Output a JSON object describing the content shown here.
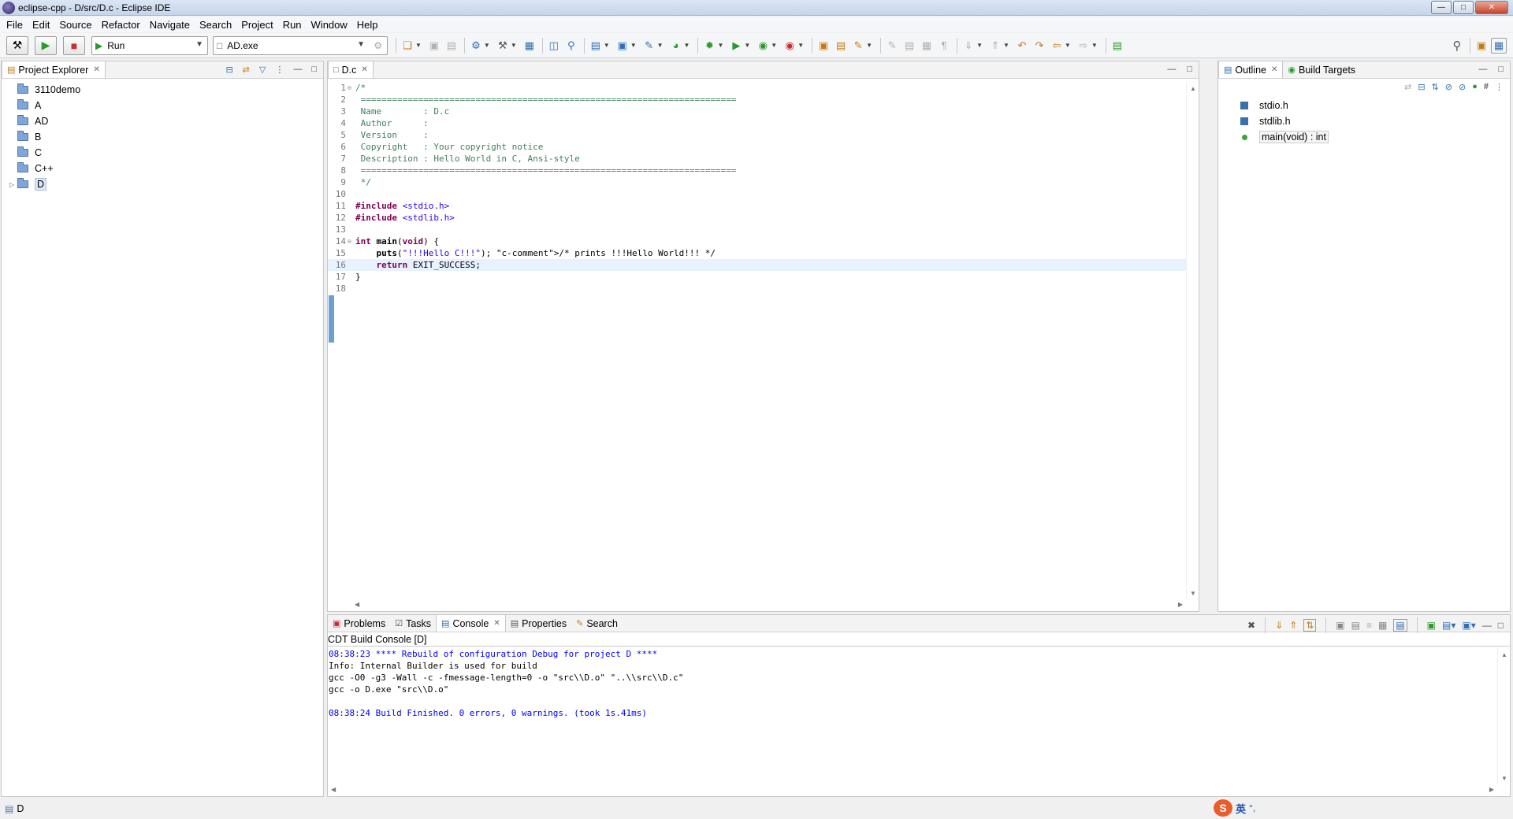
{
  "window": {
    "title": "eclipse-cpp - D/src/D.c - Eclipse IDE"
  },
  "menu": [
    "File",
    "Edit",
    "Source",
    "Refactor",
    "Navigate",
    "Search",
    "Project",
    "Run",
    "Window",
    "Help"
  ],
  "toolbar": {
    "launch_mode": "Run",
    "launch_config": "AD.exe"
  },
  "project_explorer": {
    "title": "Project Explorer",
    "items": [
      "3110demo",
      "A",
      "AD",
      "B",
      "C",
      "C++",
      "D"
    ],
    "selected": "D"
  },
  "editor": {
    "tab": "D.c",
    "lines": [
      {
        "n": "1",
        "text": "/*"
      },
      {
        "n": "2",
        "text": " ========================================================================"
      },
      {
        "n": "3",
        "text": " Name        : D.c"
      },
      {
        "n": "4",
        "text": " Author      :"
      },
      {
        "n": "5",
        "text": " Version     :"
      },
      {
        "n": "6",
        "text": " Copyright   : Your copyright notice"
      },
      {
        "n": "7",
        "text": " Description : Hello World in C, Ansi-style"
      },
      {
        "n": "8",
        "text": " ========================================================================"
      },
      {
        "n": "9",
        "text": " */"
      },
      {
        "n": "10",
        "text": ""
      },
      {
        "n": "11",
        "text": "#include <stdio.h>"
      },
      {
        "n": "12",
        "text": "#include <stdlib.h>"
      },
      {
        "n": "13",
        "text": ""
      },
      {
        "n": "14",
        "text": "int main(void) {"
      },
      {
        "n": "15",
        "text": "    puts(\"!!!Hello C!!!\"); /* prints !!!Hello World!!! */"
      },
      {
        "n": "16",
        "text": "    return EXIT_SUCCESS;"
      },
      {
        "n": "17",
        "text": "}"
      },
      {
        "n": "18",
        "text": ""
      }
    ]
  },
  "outline": {
    "tabs": [
      "Outline",
      "Build Targets"
    ],
    "items": [
      "stdio.h",
      "stdlib.h",
      "main(void) : int"
    ]
  },
  "console": {
    "tabs": [
      "Problems",
      "Tasks",
      "Console",
      "Properties",
      "Search"
    ],
    "label": "CDT Build Console [D]",
    "lines": [
      "08:38:23 **** Rebuild of configuration Debug for project D ****",
      "Info: Internal Builder is used for build",
      "gcc -O0 -g3 -Wall -c -fmessage-length=0 -o \"src\\\\D.o\" \"..\\\\src\\\\D.c\"",
      "gcc -o D.exe \"src\\\\D.o\"",
      "",
      "08:38:24 Build Finished. 0 errors, 0 warnings. (took 1s.41ms)"
    ]
  },
  "status": {
    "project": "D",
    "ime_logo": "S",
    "ime_lang": "英",
    "ime_punct": "°,"
  },
  "colors": {
    "keyword": "#7f0055",
    "comment": "#3f7f5f",
    "string": "#2a00ff",
    "console_info": "#0000ff"
  }
}
